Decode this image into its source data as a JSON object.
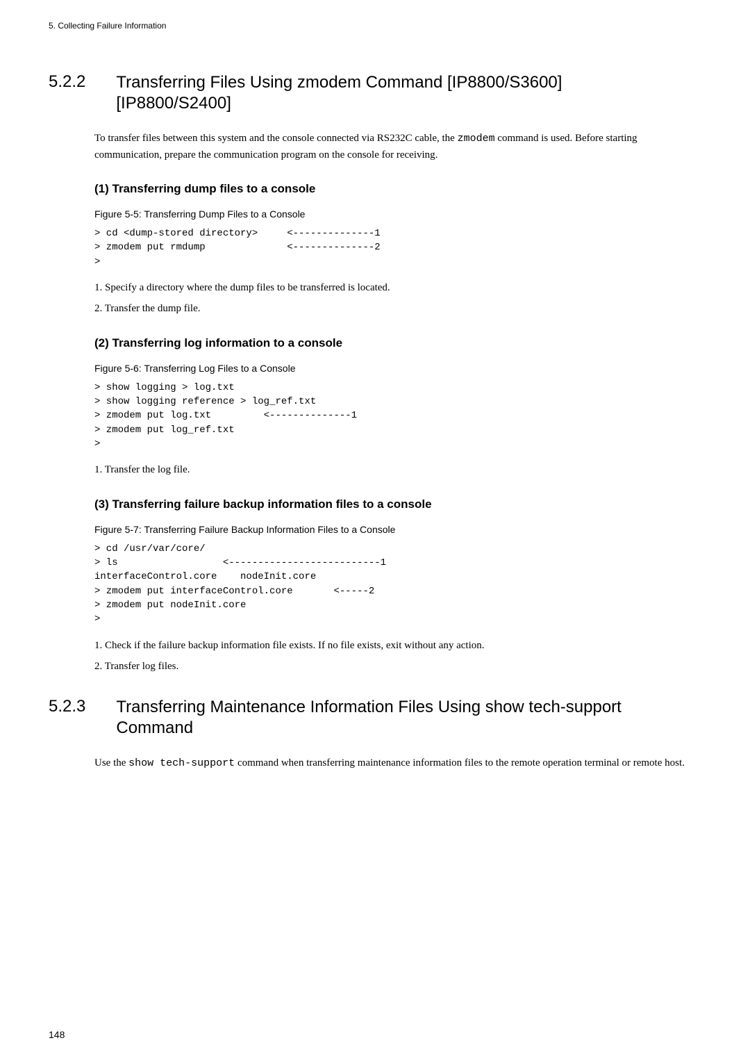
{
  "header": "5.   Collecting Failure Information",
  "section522": {
    "number": "5.2.2",
    "title": "Transferring Files Using zmodem Command [IP8800/S3600] [IP8800/S2400]",
    "para1a": "To transfer files between this system and the console connected via RS232C cable, the ",
    "para1cmd": "zmodem",
    "para1b": " command is used. Before starting communication, prepare the communication program on the console for receiving.",
    "sub1": {
      "title": "(1)   Transferring dump files to a console",
      "figcap": "Figure 5-5: Transferring Dump Files to a Console",
      "code": "> cd <dump-stored directory>     <--------------1\n> zmodem put rmdump              <--------------2\n>",
      "li1": "1.  Specify a directory where the dump files to be transferred is located.",
      "li2": "2.  Transfer the dump file."
    },
    "sub2": {
      "title": "(2)   Transferring log information to a console",
      "figcap": "Figure 5-6: Transferring Log Files to a Console",
      "code": "> show logging > log.txt\n> show logging reference > log_ref.txt\n> zmodem put log.txt         <--------------1\n> zmodem put log_ref.txt\n>",
      "li1": "1.  Transfer the log file."
    },
    "sub3": {
      "title": "(3)   Transferring failure backup information files to a console",
      "figcap": "Figure 5-7: Transferring Failure Backup Information Files to a Console",
      "code": "> cd /usr/var/core/\n> ls                  <--------------------------1\ninterfaceControl.core    nodeInit.core\n> zmodem put interfaceControl.core       <-----2\n> zmodem put nodeInit.core\n>",
      "li1": "1.  Check if the failure backup information file exists. If no file exists, exit without any action.",
      "li2": "2.  Transfer log files."
    }
  },
  "section523": {
    "number": "5.2.3",
    "title": "Transferring Maintenance Information Files Using show tech-support Command",
    "para1a": "Use the ",
    "para1cmd": "show tech-support",
    "para1b": " command when transferring maintenance information files to the remote operation terminal or remote host."
  },
  "pagenum": "148"
}
